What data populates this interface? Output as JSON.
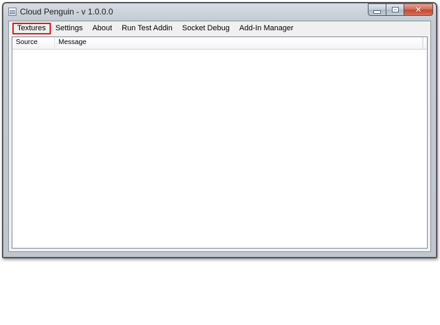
{
  "window": {
    "title": "Cloud Penguin - v 1.0.0.0",
    "icon": "app-window-icon"
  },
  "caption_buttons": {
    "minimize_icon": "minimize-icon",
    "maximize_icon": "maximize-icon",
    "close_icon": "close-icon",
    "close_glyph": "✕",
    "close_color": "#c7462c"
  },
  "menu": {
    "items": [
      {
        "label": "Textures",
        "selected": true
      },
      {
        "label": "Settings"
      },
      {
        "label": "About"
      },
      {
        "label": "Run Test Addin"
      },
      {
        "label": "Socket Debug"
      },
      {
        "label": "Add-In Manager"
      }
    ],
    "highlight_color": "#e21b1b"
  },
  "log_list": {
    "columns": [
      "Source",
      "Message"
    ],
    "rows": []
  }
}
